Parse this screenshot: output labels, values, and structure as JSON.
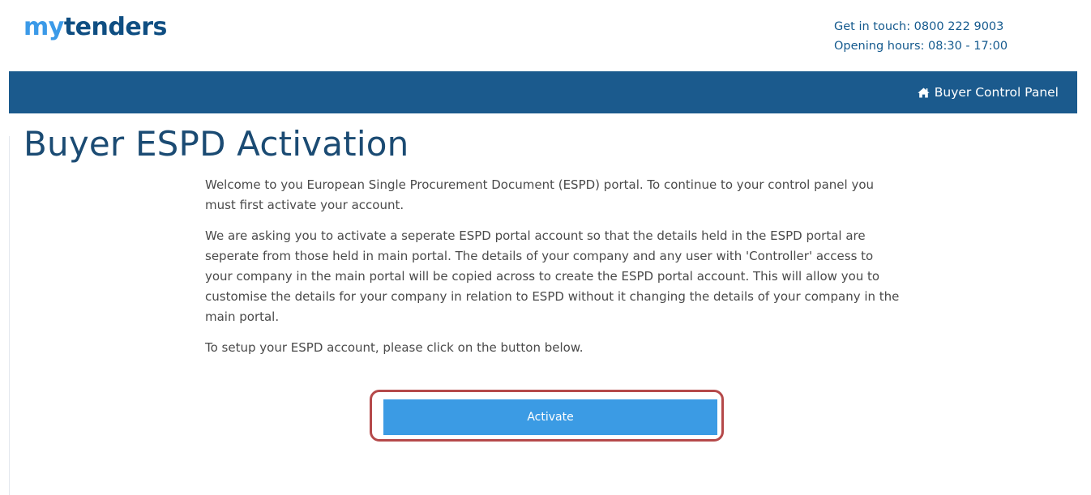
{
  "header": {
    "logo_my": "my",
    "logo_tenders": "tenders",
    "contact_phone": "Get in touch: 0800 222 9003",
    "contact_hours": "Opening hours: 08:30 - 17:00"
  },
  "nav": {
    "buyer_control_panel": "Buyer Control Panel",
    "icon": "home-icon"
  },
  "main": {
    "title": "Buyer ESPD Activation",
    "paragraph1": "Welcome to you European Single Procurement Document (ESPD) portal. To continue to your control panel you must first activate your account.",
    "paragraph2": "We are asking you to activate a seperate ESPD portal account so that the details held in the ESPD portal are seperate from those held in main portal. The details of your company and any user with 'Controller' access to your company in the main portal will be copied across to create the ESPD portal account. This will allow you to customise the details for your company in relation to ESPD without it changing the details of your company in the main portal.",
    "paragraph3": "To setup your ESPD account, please click on the button below.",
    "activate_label": "Activate"
  },
  "colors": {
    "brand_light": "#3b9ae8",
    "brand_dark": "#0f4e82",
    "navbar": "#1b5a8d",
    "button": "#3b9be4",
    "highlight": "#b5494a"
  }
}
